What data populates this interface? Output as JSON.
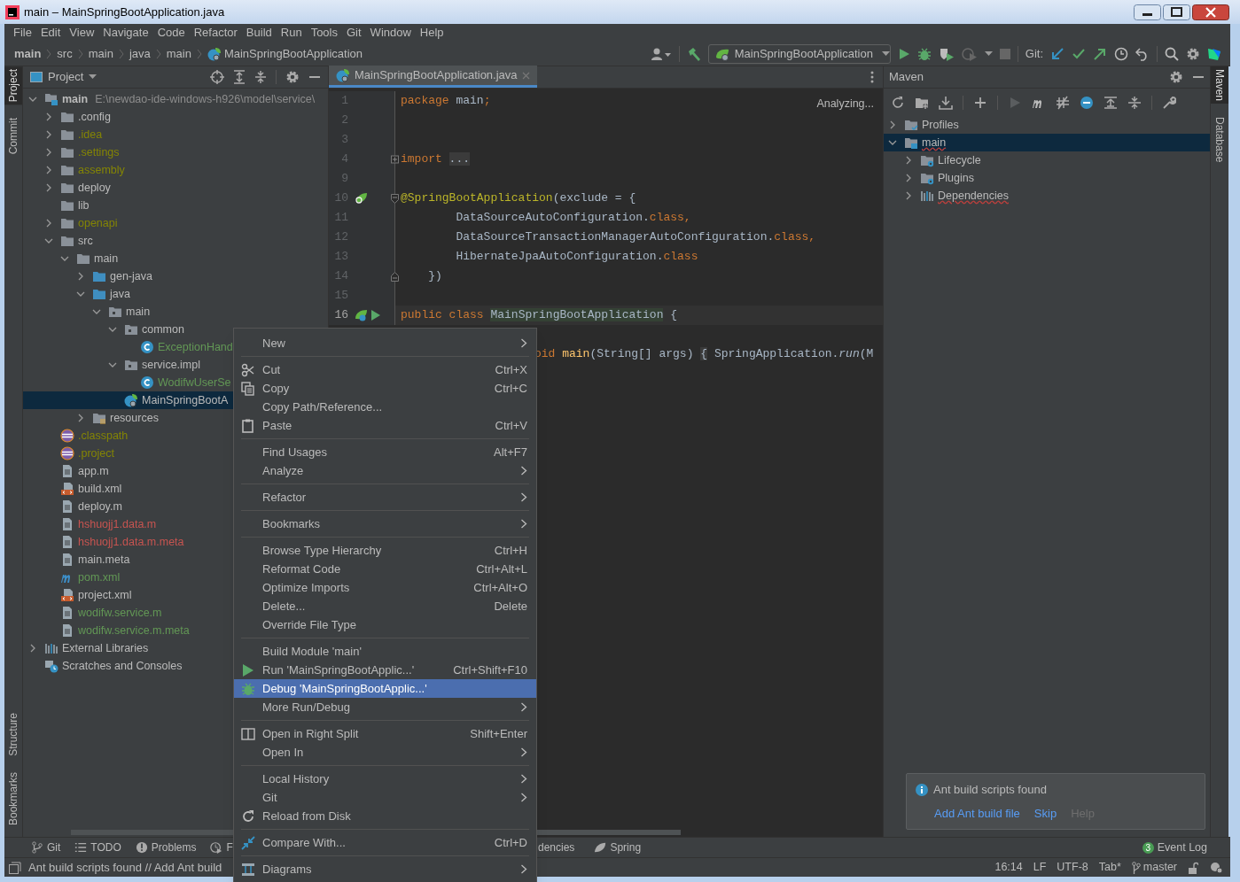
{
  "window": {
    "title": "main – MainSpringBootApplication.java"
  },
  "menu_bar": [
    "File",
    "Edit",
    "View",
    "Navigate",
    "Code",
    "Refactor",
    "Build",
    "Run",
    "Tools",
    "Git",
    "Window",
    "Help"
  ],
  "breadcrumbs": [
    {
      "label": "main",
      "kind": "module"
    },
    {
      "label": "src",
      "kind": "dir"
    },
    {
      "label": "main",
      "kind": "dir"
    },
    {
      "label": "java",
      "kind": "dir"
    },
    {
      "label": "main",
      "kind": "dir"
    },
    {
      "label": "MainSpringBootApplication",
      "kind": "spring"
    }
  ],
  "toolbar": {
    "run_config": "MainSpringBootApplication",
    "git_label": "Git:"
  },
  "left_stripe": {
    "top": [
      {
        "label": "Project",
        "selected": true
      },
      {
        "label": "Commit",
        "selected": false
      }
    ],
    "bottom": [
      {
        "label": "Structure",
        "selected": false
      },
      {
        "label": "Bookmarks",
        "selected": false
      }
    ]
  },
  "right_stripe": [
    {
      "label": "Maven",
      "selected": true
    },
    {
      "label": "Database",
      "selected": false
    }
  ],
  "project_panel": {
    "title": "Project",
    "tree": [
      {
        "label": "main",
        "kind": "module",
        "hint": "E:\\newdao-ide-windows-h926\\model\\service\\",
        "expanded": true,
        "selected": false,
        "children": [
          {
            "label": ".config",
            "kind": "folder",
            "expanded": false,
            "selected": false
          },
          {
            "label": ".idea",
            "kind": "folder",
            "color": "#848504",
            "expanded": false,
            "selected": false
          },
          {
            "label": ".settings",
            "kind": "folder",
            "color": "#848504",
            "expanded": false,
            "selected": false
          },
          {
            "label": "assembly",
            "kind": "folder",
            "color": "#848504",
            "expanded": false,
            "selected": false
          },
          {
            "label": "deploy",
            "kind": "folder",
            "expanded": false,
            "selected": false
          },
          {
            "label": "lib",
            "kind": "folder",
            "selected": false
          },
          {
            "label": "openapi",
            "kind": "folder",
            "color": "#848504",
            "expanded": false,
            "selected": false
          },
          {
            "label": "src",
            "kind": "folder",
            "expanded": true,
            "selected": false,
            "children": [
              {
                "label": "main",
                "kind": "folder",
                "expanded": true,
                "selected": false,
                "children": [
                  {
                    "label": "gen-java",
                    "kind": "source",
                    "expanded": false,
                    "selected": false
                  },
                  {
                    "label": "java",
                    "kind": "source",
                    "expanded": true,
                    "selected": false,
                    "children": [
                      {
                        "label": "main",
                        "kind": "package",
                        "expanded": true,
                        "selected": false,
                        "children": [
                          {
                            "label": "common",
                            "kind": "package",
                            "expanded": true,
                            "selected": false,
                            "children": [
                              {
                                "label": "ExceptionHand",
                                "kind": "class",
                                "color": "#629755",
                                "selected": false
                              }
                            ]
                          },
                          {
                            "label": "service.impl",
                            "kind": "package",
                            "expanded": true,
                            "selected": false,
                            "children": [
                              {
                                "label": "WodifwUserSe",
                                "kind": "class",
                                "color": "#629755",
                                "selected": false
                              }
                            ]
                          },
                          {
                            "label": "MainSpringBootA",
                            "kind": "spring",
                            "selected": true
                          }
                        ]
                      }
                    ]
                  },
                  {
                    "label": "resources",
                    "kind": "resources",
                    "expanded": false,
                    "selected": false
                  }
                ]
              }
            ]
          },
          {
            "label": ".classpath",
            "kind": "eclipse",
            "color": "#848504",
            "selected": false
          },
          {
            "label": ".project",
            "kind": "eclipse",
            "color": "#848504",
            "selected": false
          },
          {
            "label": "app.m",
            "kind": "file",
            "selected": false
          },
          {
            "label": "build.xml",
            "kind": "xml",
            "selected": false
          },
          {
            "label": "deploy.m",
            "kind": "file",
            "selected": false
          },
          {
            "label": "hshuojj1.data.m",
            "kind": "file",
            "color": "#c75450",
            "selected": false
          },
          {
            "label": "hshuojj1.data.m.meta",
            "kind": "file",
            "color": "#c75450",
            "selected": false
          },
          {
            "label": "main.meta",
            "kind": "file",
            "selected": false
          },
          {
            "label": "pom.xml",
            "kind": "maven",
            "color": "#629755",
            "selected": false
          },
          {
            "label": "project.xml",
            "kind": "xml",
            "selected": false
          },
          {
            "label": "wodifw.service.m",
            "kind": "file",
            "color": "#629755",
            "selected": false
          },
          {
            "label": "wodifw.service.m.meta",
            "kind": "file",
            "color": "#629755",
            "selected": false
          }
        ]
      },
      {
        "label": "External Libraries",
        "kind": "libs",
        "expanded": false,
        "selected": false
      },
      {
        "label": "Scratches and Consoles",
        "kind": "scratch",
        "selected": false
      }
    ]
  },
  "editor": {
    "tab": {
      "label": "MainSpringBootApplication.java",
      "selected": true
    },
    "status": "Analyzing...",
    "lines": [
      {
        "number": "1",
        "kind": "code",
        "current": false,
        "tokens": [
          {
            "text": "package ",
            "kind": "kw"
          },
          {
            "text": "main",
            "kind": "plain"
          },
          {
            "text": ";",
            "kind": "kw"
          }
        ]
      },
      {
        "number": "2",
        "kind": "blank",
        "current": false
      },
      {
        "number": "3",
        "kind": "blank",
        "current": false
      },
      {
        "number": "4",
        "kind": "import",
        "current": false,
        "tokens": [
          {
            "text": "import ",
            "kind": "kw"
          },
          {
            "text": "...",
            "kind": "folded"
          }
        ]
      },
      {
        "number": "9",
        "kind": "blank",
        "current": false
      },
      {
        "number": "10",
        "kind": "bean_annotation",
        "current": false,
        "tokens": [
          {
            "text": "@SpringBootApplication",
            "kind": "ann"
          },
          {
            "text": "(exclude = {",
            "kind": "plain"
          }
        ]
      },
      {
        "number": "11",
        "kind": "code",
        "current": false,
        "tokens": [
          {
            "text": "        DataSourceAutoConfiguration.",
            "kind": "plain"
          },
          {
            "text": "class,",
            "kind": "kw"
          }
        ]
      },
      {
        "number": "12",
        "kind": "code",
        "current": false,
        "tokens": [
          {
            "text": "        DataSourceTransactionManagerAutoConfiguration.",
            "kind": "plain"
          },
          {
            "text": "class,",
            "kind": "kw"
          }
        ]
      },
      {
        "number": "13",
        "kind": "code",
        "current": false,
        "tokens": [
          {
            "text": "        HibernateJpaAutoConfiguration.",
            "kind": "plain"
          },
          {
            "text": "class",
            "kind": "kw"
          }
        ]
      },
      {
        "number": "14",
        "kind": "fold_end",
        "current": false,
        "tokens": [
          {
            "text": "    })",
            "kind": "plain"
          }
        ]
      },
      {
        "number": "15",
        "kind": "blank",
        "current": false
      },
      {
        "number": "16",
        "kind": "main_class",
        "current": true,
        "tokens": [
          {
            "text": "public class ",
            "kind": "kw"
          },
          {
            "text": "MainSpringBootApplication",
            "kind": "hl"
          },
          {
            "text": " {",
            "kind": "plain"
          }
        ]
      }
    ],
    "partial_line": [
      {
        "text": "oid ",
        "kind": "kw"
      },
      {
        "text": "main",
        "kind": "method"
      },
      {
        "text": "(String[] args) ",
        "kind": "plain"
      },
      {
        "text": "{",
        "kind": "folded"
      },
      {
        "text": " SpringApplication.",
        "kind": "plain"
      },
      {
        "text": "run",
        "kind": "italic"
      },
      {
        "text": "(M",
        "kind": "plain"
      }
    ]
  },
  "maven": {
    "title": "Maven",
    "tree": [
      {
        "label": "Profiles",
        "kind": "profiles",
        "expanded": false,
        "selected": false,
        "error": false
      },
      {
        "label": "main",
        "kind": "maven_module",
        "expanded": true,
        "selected": true,
        "error": true,
        "children": [
          {
            "label": "Lifecycle",
            "kind": "lifecycle",
            "expanded": false,
            "selected": false,
            "error": false
          },
          {
            "label": "Plugins",
            "kind": "plugins",
            "expanded": false,
            "selected": false,
            "error": false
          },
          {
            "label": "Dependencies",
            "kind": "libs",
            "expanded": false,
            "selected": false,
            "error": true
          }
        ]
      }
    ]
  },
  "notification": {
    "title": "Ant build scripts found",
    "actions": [
      {
        "label": "Add Ant build file",
        "disabled": false
      },
      {
        "label": "Skip",
        "disabled": false
      },
      {
        "label": "Help",
        "disabled": true
      }
    ]
  },
  "tool_strip": {
    "left": [
      {
        "label": "Git",
        "kind": "git"
      },
      {
        "label": "TODO",
        "kind": "todo"
      },
      {
        "label": "Problems",
        "kind": "problems"
      },
      {
        "label": "F",
        "kind": "profiler"
      }
    ],
    "middle": [
      {
        "label": "dencies",
        "kind": "none"
      },
      {
        "label": "Spring",
        "kind": "spring"
      }
    ],
    "event_log": {
      "count": "3",
      "label": "Event Log"
    }
  },
  "status_bar": {
    "message": "Ant build scripts found // Add Ant build",
    "items": [
      "16:14",
      "LF",
      "UTF-8",
      "Tab*"
    ],
    "branch": "master"
  },
  "context_menu": {
    "groups": [
      [
        {
          "label": "New",
          "submenu": true,
          "selected": false
        }
      ],
      [
        {
          "label": "Cut",
          "kind": "cut",
          "shortcut": "Ctrl+X",
          "selected": false
        },
        {
          "label": "Copy",
          "kind": "copy",
          "shortcut": "Ctrl+C",
          "selected": false
        },
        {
          "label": "Copy Path/Reference...",
          "selected": false
        },
        {
          "label": "Paste",
          "kind": "paste",
          "shortcut": "Ctrl+V",
          "selected": false
        }
      ],
      [
        {
          "label": "Find Usages",
          "shortcut": "Alt+F7",
          "selected": false
        },
        {
          "label": "Analyze",
          "submenu": true,
          "selected": false
        }
      ],
      [
        {
          "label": "Refactor",
          "submenu": true,
          "selected": false
        }
      ],
      [
        {
          "label": "Bookmarks",
          "submenu": true,
          "selected": false
        }
      ],
      [
        {
          "label": "Browse Type Hierarchy",
          "shortcut": "Ctrl+H",
          "selected": false
        },
        {
          "label": "Reformat Code",
          "shortcut": "Ctrl+Alt+L",
          "selected": false
        },
        {
          "label": "Optimize Imports",
          "shortcut": "Ctrl+Alt+O",
          "selected": false
        },
        {
          "label": "Delete...",
          "shortcut": "Delete",
          "selected": false
        },
        {
          "label": "Override File Type",
          "selected": false
        }
      ],
      [
        {
          "label": "Build Module 'main'",
          "selected": false
        },
        {
          "label": "Run 'MainSpringBootApplic...'",
          "kind": "run",
          "shortcut": "Ctrl+Shift+F10",
          "selected": false
        },
        {
          "label": "Debug 'MainSpringBootApplic...'",
          "kind": "debug",
          "selected": true
        },
        {
          "label": "More Run/Debug",
          "submenu": true,
          "selected": false
        }
      ],
      [
        {
          "label": "Open in Right Split",
          "kind": "split",
          "shortcut": "Shift+Enter",
          "selected": false
        },
        {
          "label": "Open In",
          "submenu": true,
          "selected": false
        }
      ],
      [
        {
          "label": "Local History",
          "submenu": true,
          "selected": false
        },
        {
          "label": "Git",
          "submenu": true,
          "selected": false
        },
        {
          "label": "Reload from Disk",
          "kind": "reload",
          "selected": false
        }
      ],
      [
        {
          "label": "Compare With...",
          "kind": "compare",
          "shortcut": "Ctrl+D",
          "selected": false
        }
      ],
      [
        {
          "label": "Diagrams",
          "kind": "diagram",
          "submenu": true,
          "selected": false
        }
      ]
    ]
  }
}
